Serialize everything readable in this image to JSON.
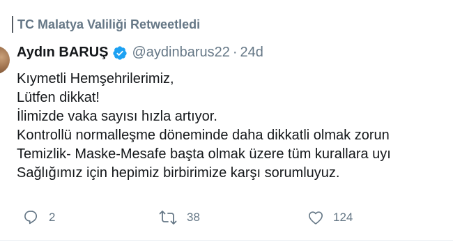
{
  "retweet_context": {
    "text": "TC Malatya Valiliği Retweetledi"
  },
  "author": {
    "name": "Aydın BARUŞ",
    "handle": "@aydinbarus22",
    "separator": "·",
    "time": "24d",
    "verified": true
  },
  "tweet": {
    "lines": [
      "Kıymetli Hemşehrilerimiz,",
      "Lütfen dikkat!",
      "İlimizde vaka sayısı hızla artıyor.",
      "Kontrollü normalleşme döneminde daha dikkatli olmak zorun",
      "Temizlik- Maske-Mesafe başta olmak üzere tüm kurallara uyı",
      "Sağlığımız için hepimiz birbirimize karşı sorumluyuz."
    ]
  },
  "actions": {
    "reply_count": "2",
    "retweet_count": "38",
    "like_count": "124"
  },
  "colors": {
    "text": "#14171a",
    "secondary": "#657786",
    "verified": "#1da1f2",
    "divider": "#e6ecf0"
  },
  "icons": {
    "reply": "reply-icon",
    "retweet": "retweet-icon",
    "like": "heart-icon",
    "verified": "verified-badge-icon"
  }
}
